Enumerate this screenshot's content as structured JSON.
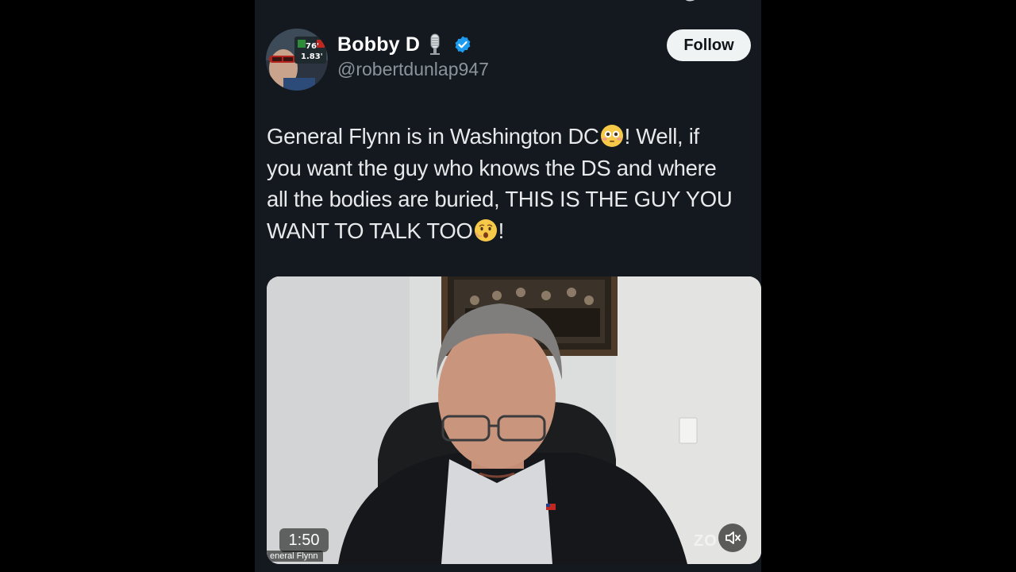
{
  "author": {
    "display_name": "Bobby D",
    "handle": "@robertdunlap947",
    "name_icon": "microphone-icon",
    "verified_icon": "verified-badge-icon",
    "avatar_badge_top": "76'",
    "avatar_badge_bottom": "1.83'"
  },
  "follow_button": {
    "label": "Follow"
  },
  "tweet": {
    "line1_a": "General Flynn is in Washington DC",
    "line1_emoji": "flushed-face-emoji",
    "line1_b": "! Well, if",
    "line2": "you want the guy who knows the DS and where",
    "line3": "all the bodies are buried, THIS IS THE GUY YOU",
    "line4_a": "WANT TO TALK TOO",
    "line4_emoji": "face-with-open-mouth-emoji",
    "line4_b": "!"
  },
  "video": {
    "timestamp": "1:50",
    "participant_name": "eneral Flynn",
    "watermark": "ZO",
    "mute_icon": "speaker-muted-icon"
  },
  "colors": {
    "background": "#14181f",
    "text": "#e7e9ea",
    "handle": "#8b949d",
    "verified": "#1d9bf0",
    "follow_bg": "#eff3f4"
  }
}
